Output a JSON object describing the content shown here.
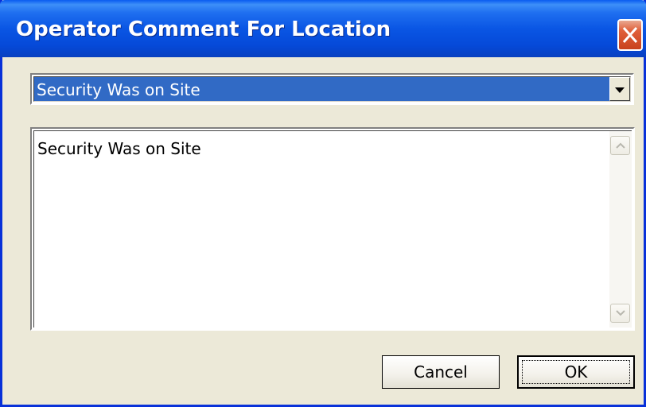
{
  "window": {
    "title": "Operator Comment For Location"
  },
  "dropdown": {
    "selected": "Security Was on Site"
  },
  "comment": {
    "text": "Security Was on Site"
  },
  "buttons": {
    "cancel": "Cancel",
    "ok": "OK"
  },
  "icons": {
    "close": "close-icon",
    "dropdown": "chevron-down-icon",
    "scroll_up": "scroll-up-icon",
    "scroll_down": "scroll-down-icon"
  },
  "colors": {
    "titlebar": "#0a56e4",
    "selection": "#316ac5",
    "close": "#e0603a",
    "dialog_bg": "#ece9d8"
  }
}
